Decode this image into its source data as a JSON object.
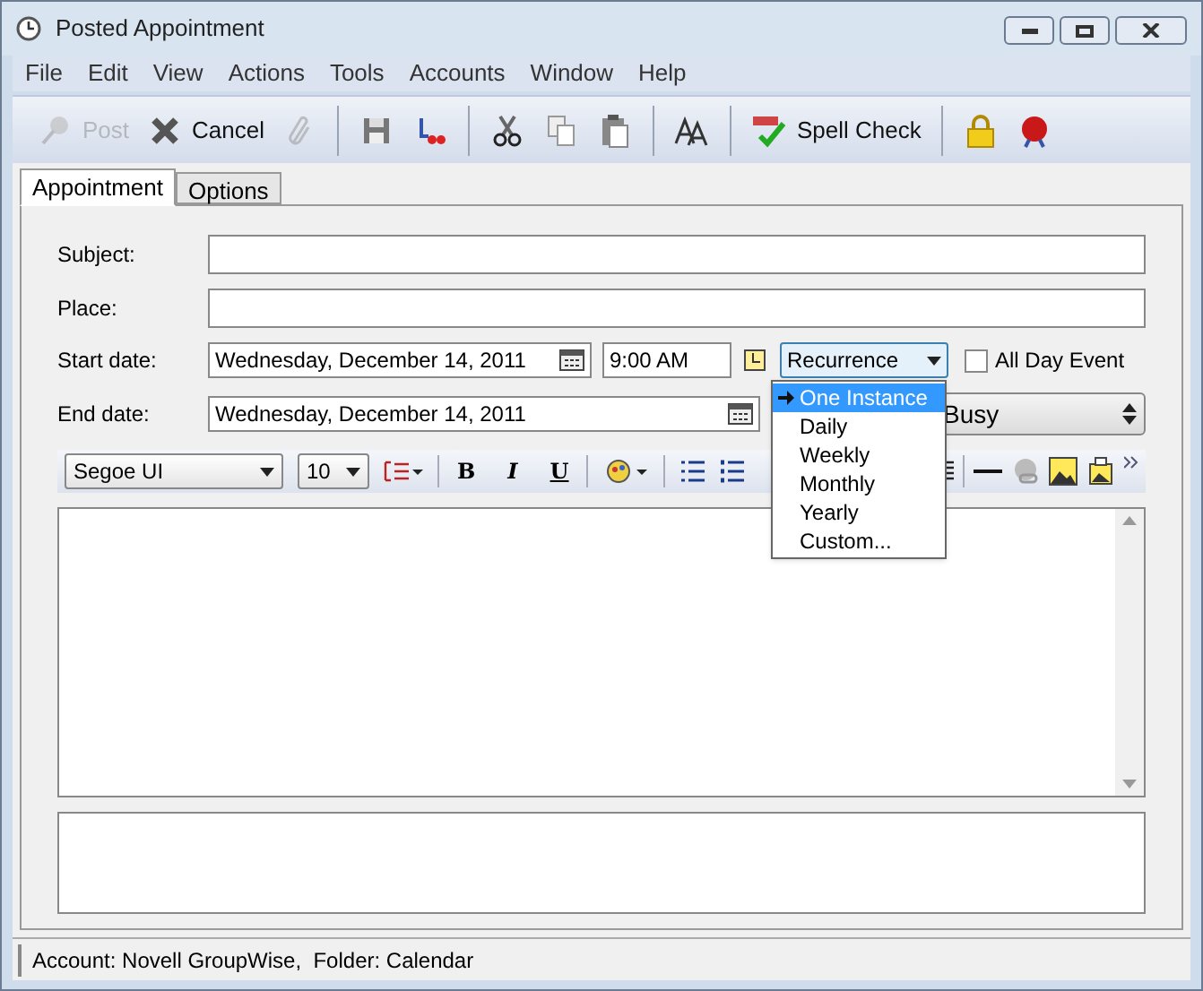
{
  "window": {
    "title": "Posted Appointment"
  },
  "menu": [
    "File",
    "Edit",
    "View",
    "Actions",
    "Tools",
    "Accounts",
    "Window",
    "Help"
  ],
  "toolbar": [
    {
      "kind": "button",
      "label": "Post",
      "disabled": true
    },
    {
      "kind": "button",
      "label": "Cancel",
      "disabled": false
    },
    {
      "kind": "button",
      "disabled": true
    },
    {
      "kind": "sep"
    },
    {
      "kind": "button",
      "disabled": false
    },
    {
      "kind": "button",
      "disabled": false
    },
    {
      "kind": "sep"
    },
    {
      "kind": "button",
      "disabled": false
    },
    {
      "kind": "button",
      "disabled": false
    },
    {
      "kind": "button",
      "disabled": false
    },
    {
      "kind": "sep"
    },
    {
      "kind": "button",
      "disabled": false
    },
    {
      "kind": "sep"
    },
    {
      "kind": "button",
      "label": "Spell Check",
      "disabled": false
    },
    {
      "kind": "sep"
    },
    {
      "kind": "button",
      "disabled": false
    },
    {
      "kind": "button",
      "disabled": false
    }
  ],
  "tabs": [
    {
      "label": "Appointment",
      "selected": true
    },
    {
      "label": "Options",
      "selected": false
    }
  ],
  "subject": {
    "label": "Subject:"
  },
  "place": {
    "label": "Place:"
  },
  "start": {
    "label": "Start date:",
    "date": "Wednesday, December 14, 2011",
    "time": "9:00 AM",
    "recurrence": "Recurrence",
    "all_day": {
      "label": "All Day Event",
      "checked": false
    }
  },
  "end": {
    "label": "End date:",
    "date": "Wednesday, December 14, 2011",
    "show_as": "Busy"
  },
  "format": {
    "font": "Segoe UI",
    "size": "10",
    "styles": [
      "B",
      "I",
      "U"
    ]
  },
  "recurrence_menu": [
    {
      "label": "One Instance",
      "selected": true
    },
    {
      "label": "Daily",
      "selected": false
    },
    {
      "label": "Weekly",
      "selected": false
    },
    {
      "label": "Monthly",
      "selected": false
    },
    {
      "label": "Yearly",
      "selected": false
    },
    {
      "label": "Custom...",
      "selected": false
    }
  ],
  "status_bar": "Account: Novell GroupWise,  Folder: Calendar"
}
